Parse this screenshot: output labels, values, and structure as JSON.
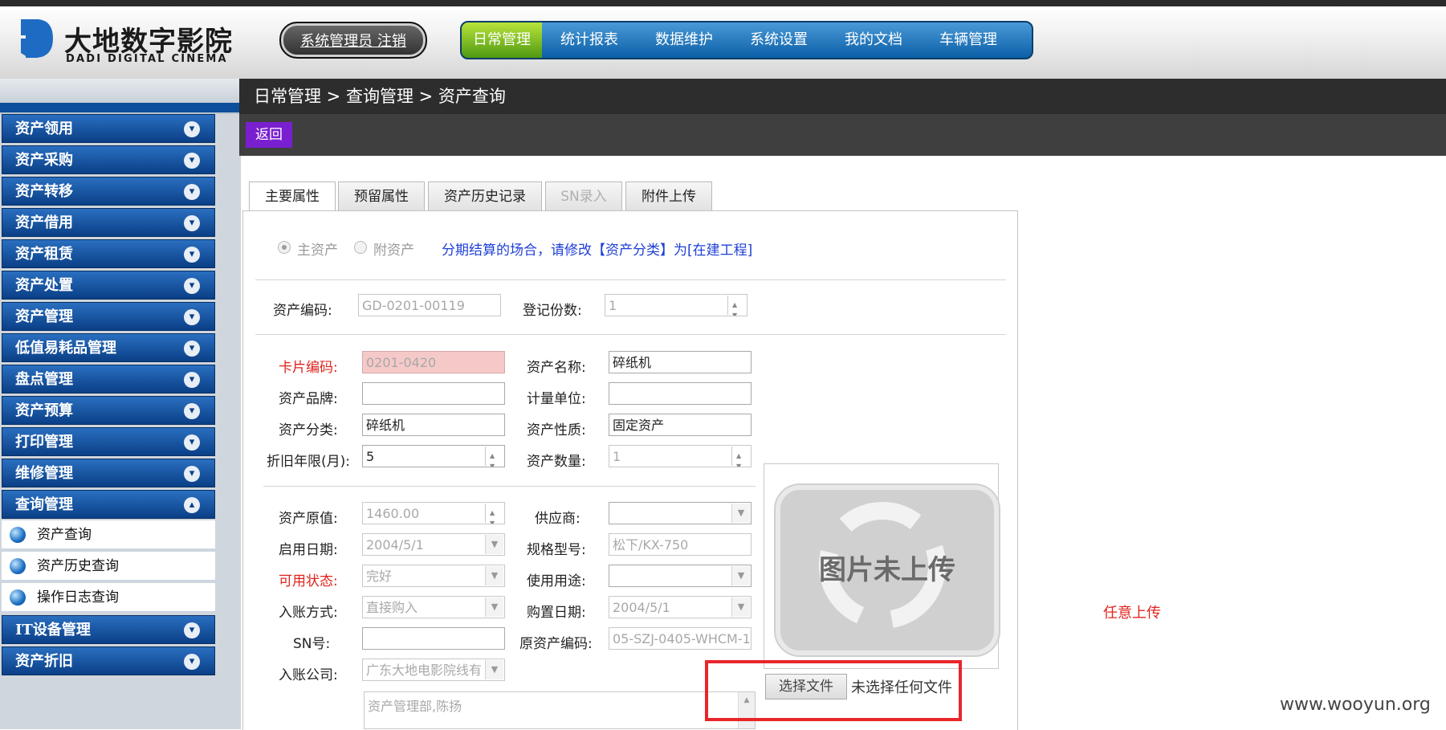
{
  "logo": {
    "name_cn": "大地数字影院",
    "name_en": "DADI DIGITAL CINEMA"
  },
  "header": {
    "admin_link": "系统管理员 注销"
  },
  "top_nav": [
    "日常管理",
    "统计报表",
    "数据维护",
    "系统设置",
    "我的文档",
    "车辆管理"
  ],
  "sidebar": {
    "items": [
      "资产领用",
      "资产采购",
      "资产转移",
      "资产借用",
      "资产租赁",
      "资产处置",
      "资产管理",
      "低值易耗品管理",
      "盘点管理",
      "资产预算",
      "打印管理",
      "维修管理",
      "查询管理"
    ],
    "expanded_sub": [
      "资产查询",
      "资产历史查询",
      "操作日志查询"
    ],
    "bottom_items": [
      "IT设备管理",
      "资产折旧"
    ]
  },
  "breadcrumb": "日常管理 > 查询管理 > 资产查询",
  "back_button": "返回",
  "tabs": [
    "主要属性",
    "预留属性",
    "资产历史记录",
    "SN录入",
    "附件上传"
  ],
  "radio": {
    "main": "主资产",
    "sub": "附资产",
    "notice": "分期结算的场合，请修改【资产分类】为[在建工程]"
  },
  "fields": {
    "asset_code_label": "资产编码:",
    "asset_code": "GD-0201-00119",
    "reg_count_label": "登记份数:",
    "reg_count": "1",
    "card_code_label": "卡片编码:",
    "card_code": "0201-0420",
    "asset_name_label": "资产名称:",
    "asset_name": "碎纸机",
    "brand_label": "资产品牌:",
    "brand": "",
    "unit_label": "计量单位:",
    "unit": "",
    "category_label": "资产分类:",
    "category": "碎纸机",
    "nature_label": "资产性质:",
    "nature": "固定资产",
    "depr_label": "折旧年限(月):",
    "depr": "5",
    "qty_label": "资产数量:",
    "qty": "1",
    "orig_value_label": "资产原值:",
    "orig_value": "1460.00",
    "supplier_label": "供应商:",
    "supplier": "",
    "start_date_label": "启用日期:",
    "start_date": "2004/5/1",
    "spec_label": "规格型号:",
    "spec": "松下/KX-750",
    "status_label": "可用状态:",
    "status": "完好",
    "usage_label": "使用用途:",
    "usage": "",
    "entry_label": "入账方式:",
    "entry": "直接购入",
    "purchase_label": "购置日期:",
    "purchase": "2004/5/1",
    "sn_label": "SN号:",
    "sn": "",
    "orig_code_label": "原资产编码:",
    "orig_code": "05-SZJ-0405-WHCM-1",
    "company_label": "入账公司:",
    "company": "广东大地电影院线有",
    "dept_text": "资产管理部,陈扬"
  },
  "image": {
    "placeholder": "图片未上传",
    "choose_file": "选择文件",
    "no_file": "未选择任何文件"
  },
  "note": "任意上传",
  "watermark": "www.wooyun.org"
}
